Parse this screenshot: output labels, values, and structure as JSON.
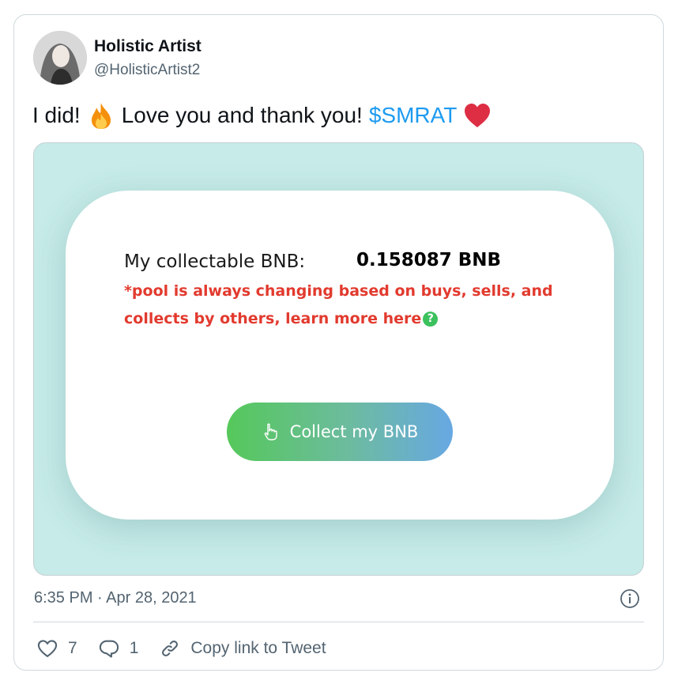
{
  "tweet": {
    "author_name": "Holistic Artist",
    "author_handle": "@HolisticArtist2",
    "text_before": "I did!",
    "text_middle": "Love you and thank you!",
    "cashtag": "$SMRAT",
    "emoji_1": "fire-emoji",
    "emoji_2": "red-heart-emoji",
    "timestamp": "6:35 PM · Apr 28, 2021"
  },
  "media": {
    "label": "My collectable BNB:",
    "amount": "0.158087 BNB",
    "warning": "*pool is always changing based on buys, sells, and collects by others, learn more here",
    "help_glyph": "?",
    "button_label": "Collect my BNB",
    "button_icon": "pointing-hand-icon",
    "background_color": "#c6ebe8",
    "warning_color": "#e23a2e"
  },
  "actions": {
    "likes_count": "7",
    "replies_count": "1",
    "copy_link_label": "Copy link to Tweet"
  },
  "colors": {
    "link": "#1d9bf0",
    "muted": "#536471",
    "border": "#cfd9de"
  }
}
